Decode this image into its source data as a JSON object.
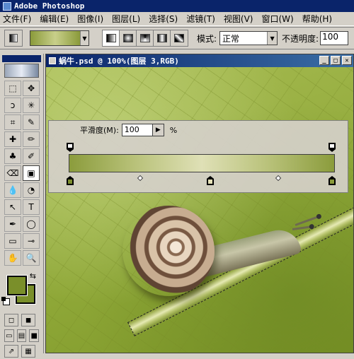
{
  "app": {
    "title": "Adobe Photoshop"
  },
  "menu": [
    "文件(F)",
    "编辑(E)",
    "图像(I)",
    "图层(L)",
    "选择(S)",
    "滤镜(T)",
    "视图(V)",
    "窗口(W)",
    "帮助(H)"
  ],
  "options": {
    "gradient_colors": [
      "#8b9c3c",
      "#dfe0b6"
    ],
    "mode_label": "模式:",
    "mode_value": "正常",
    "opacity_label": "不透明度:",
    "opacity_value": "100"
  },
  "toolbox": {
    "tools": [
      "marquee-icon",
      "move-icon",
      "lasso-icon",
      "magic-wand-icon",
      "crop-icon",
      "eyedropper-slice-icon",
      "healing-icon",
      "brush-icon",
      "stamp-icon",
      "history-brush-icon",
      "eraser-icon",
      "gradient-icon",
      "blur-icon",
      "dodge-icon",
      "path-select-icon",
      "type-icon",
      "pen-icon",
      "ellipse-icon",
      "notes-icon",
      "eyedropper-icon",
      "hand-icon",
      "zoom-icon"
    ],
    "tool_glyphs": [
      "⬚",
      "✥",
      "ↄ",
      "✳",
      "⌗",
      "✎",
      "✚",
      "✏",
      "♣",
      "✐",
      "⌫",
      "▣",
      "💧",
      "◔",
      "↖",
      "T",
      "✒",
      "◯",
      "▭",
      "⊸",
      "✋",
      "🔍"
    ],
    "foreground_color": "#7a8f2a",
    "background_color": "#7a8f2a"
  },
  "document": {
    "title": "蜗牛.psd @ 100%(图层 3,RGB)"
  },
  "gradient_panel": {
    "smoothness_label": "平滑度(M):",
    "smoothness_value": "100",
    "smoothness_unit": "%",
    "color_stops": [
      "#7d8f2e",
      "#e6e2b8",
      "#8a9b3a"
    ]
  }
}
